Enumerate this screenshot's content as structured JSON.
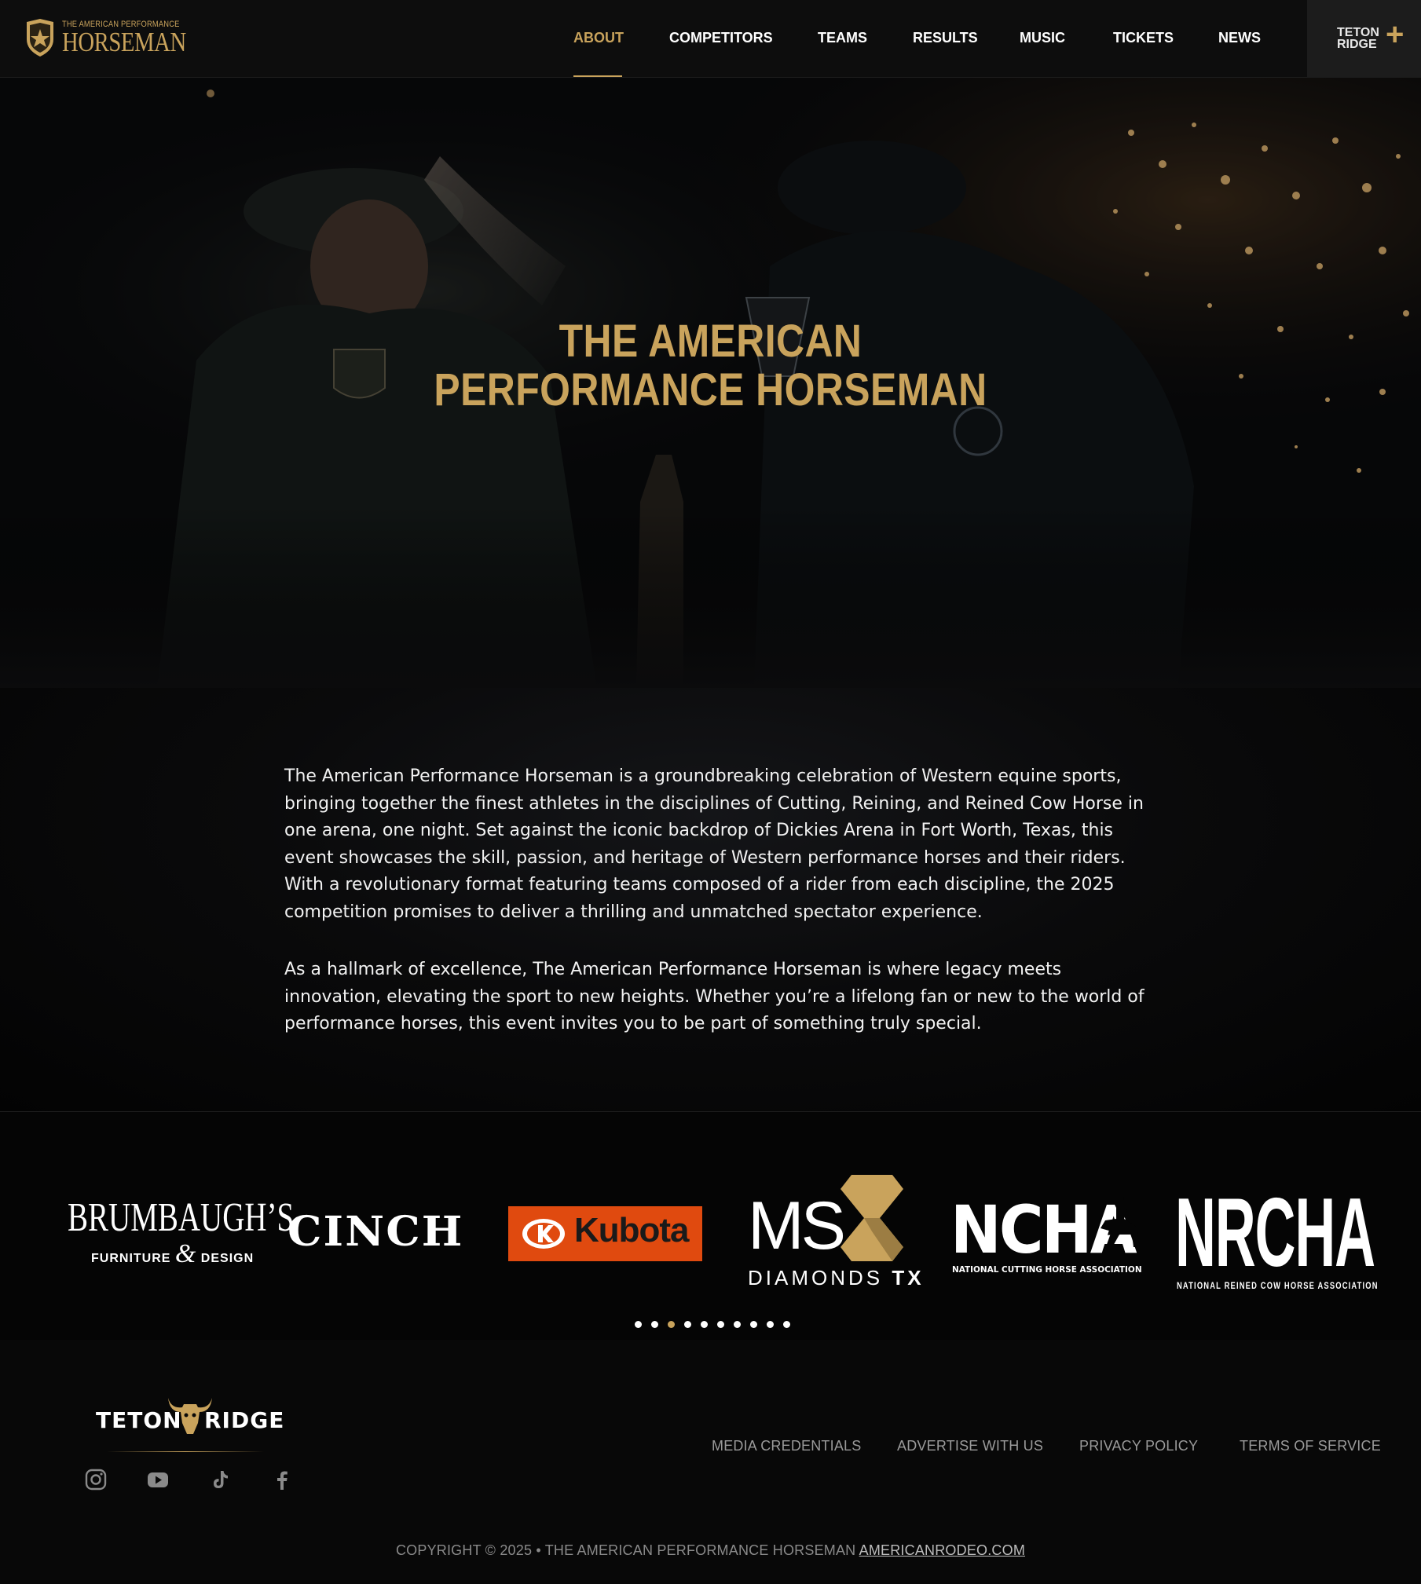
{
  "brand": {
    "logo_small": "THE AMERICAN PERFORMANCE",
    "logo_big": "HORSEMAN"
  },
  "nav": {
    "items": [
      {
        "label": "ABOUT",
        "active": true
      },
      {
        "label": "COMPETITORS"
      },
      {
        "label": "TEAMS"
      },
      {
        "label": "RESULTS"
      },
      {
        "label": "MUSIC"
      },
      {
        "label": "TICKETS"
      },
      {
        "label": "NEWS"
      }
    ],
    "teton_plus": {
      "line1": "TETON",
      "line2": "RIDGE",
      "plus": "+"
    }
  },
  "hero": {
    "title_line1": "THE AMERICAN",
    "title_line2": "PERFORMANCE HORSEMAN"
  },
  "about": {
    "paragraph1": "The American Performance Horseman is a groundbreaking celebration of Western equine sports, bringing together the finest athletes in the disciplines of Cutting, Reining, and Reined Cow Horse in one arena, one night. Set against the iconic backdrop of Dickies Arena in Fort Worth, Texas, this event showcases the skill, passion, and heritage of Western performance horses and their riders. With a revolutionary format featuring teams composed of a rider from each discipline, the 2025 competition promises to deliver a thrilling and unmatched spectator experience.",
    "paragraph2": "As a hallmark of excellence, The American Performance Horseman is where legacy meets innovation, elevating the sport to new heights. Whether you’re a lifelong fan or new to the world of performance horses, this event invites you to be part of something truly special."
  },
  "sponsors": {
    "brumbaugh": {
      "name": "BRUMBAUGH’S",
      "sub1": "FURNITURE",
      "amp": "&",
      "sub2": "DESIGN"
    },
    "cinch": {
      "name": "CINCH"
    },
    "kubota": {
      "name": "Kubota"
    },
    "ms_diamonds": {
      "name": "MS",
      "sub": "DIAMONDS",
      "tx": "TX"
    },
    "ncha": {
      "name": "NCHA",
      "sub": "NATIONAL CUTTING HORSE ASSOCIATION"
    },
    "nrcha": {
      "name": "NRCHA",
      "sub": "NATIONAL REINED COW HORSE ASSOCIATION"
    },
    "carousel_dots": 10,
    "active_dot": 2
  },
  "footer": {
    "logo_left": "TETON",
    "logo_right": "RIDGE",
    "links": [
      "MEDIA CREDENTIALS",
      "ADVERTISE WITH US",
      "PRIVACY POLICY",
      "TERMS OF SERVICE"
    ],
    "social": [
      "instagram-icon",
      "youtube-icon",
      "tiktok-icon",
      "facebook-icon"
    ],
    "copyright": "COPYRIGHT © 2025 • THE AMERICAN PERFORMANCE HORSEMAN",
    "copyright_link": "AMERICANRODEO.COM"
  },
  "colors": {
    "gold": "#c9a35c",
    "background": "#050505",
    "kubota_orange": "#e04a0f"
  }
}
